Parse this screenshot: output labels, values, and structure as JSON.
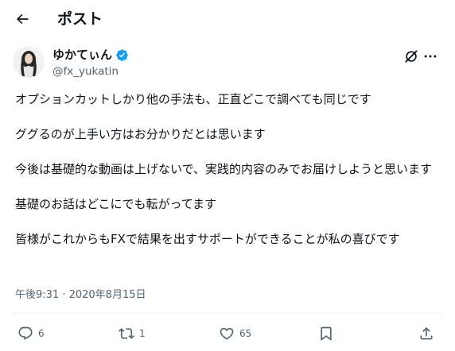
{
  "header": {
    "title": "ポスト"
  },
  "author": {
    "display_name": "ゆかてぃん",
    "handle": "@fx_yukatin"
  },
  "tweet": {
    "paragraphs": [
      "オプションカットしかり他の手法も、正直どこで調べても同じです",
      "ググるのが上手い方はお分かりだとは思います",
      "今後は基礎的な動画は上げないで、実践的内容のみでお届けしようと思います",
      "基礎のお話はどこにでも転がってます",
      "皆様がこれからもFXで結果を出すサポートができることが私の喜びです"
    ],
    "timestamp": "午後9:31 · 2020年8月15日"
  },
  "actions": {
    "replies": "6",
    "reposts": "1",
    "likes": "65"
  },
  "colors": {
    "text": "#0f1419",
    "secondary": "#536471",
    "verified": "#1d9bf0",
    "divider": "#eff3f4"
  },
  "icons": [
    "back-arrow-icon",
    "verified-badge-icon",
    "grok-icon",
    "more-icon",
    "reply-icon",
    "repost-icon",
    "like-icon",
    "bookmark-icon",
    "share-icon"
  ]
}
